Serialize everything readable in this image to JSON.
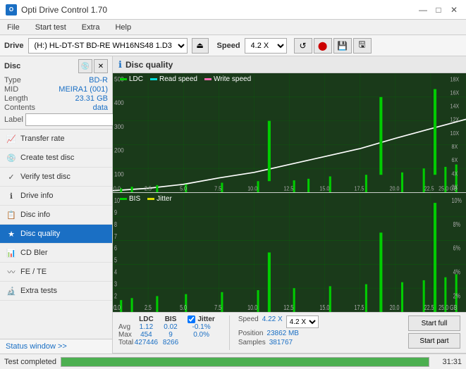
{
  "titleBar": {
    "title": "Opti Drive Control 1.70",
    "icon": "O",
    "minimizeBtn": "—",
    "maximizeBtn": "□",
    "closeBtn": "✕"
  },
  "menuBar": {
    "items": [
      "File",
      "Start test",
      "Extra",
      "Help"
    ]
  },
  "driveBar": {
    "label": "Drive",
    "driveValue": "(H:)  HL-DT-ST BD-RE  WH16NS48 1.D3",
    "speedLabel": "Speed",
    "speedValue": "4.2 X"
  },
  "sidebar": {
    "discTitle": "Disc",
    "discInfo": {
      "type": {
        "label": "Type",
        "value": "BD-R"
      },
      "mid": {
        "label": "MID",
        "value": "MEIRA1 (001)"
      },
      "length": {
        "label": "Length",
        "value": "23.31 GB"
      },
      "contents": {
        "label": "Contents",
        "value": "data"
      },
      "labelField": {
        "label": "Label",
        "placeholder": ""
      }
    },
    "navItems": [
      {
        "id": "transfer-rate",
        "label": "Transfer rate",
        "icon": "📈"
      },
      {
        "id": "create-test-disc",
        "label": "Create test disc",
        "icon": "💿"
      },
      {
        "id": "verify-test-disc",
        "label": "Verify test disc",
        "icon": "✓"
      },
      {
        "id": "drive-info",
        "label": "Drive info",
        "icon": "ℹ"
      },
      {
        "id": "disc-info",
        "label": "Disc info",
        "icon": "📋"
      },
      {
        "id": "disc-quality",
        "label": "Disc quality",
        "icon": "★",
        "active": true
      },
      {
        "id": "cd-bler",
        "label": "CD Bler",
        "icon": "📊"
      },
      {
        "id": "fe-te",
        "label": "FE / TE",
        "icon": "〰"
      },
      {
        "id": "extra-tests",
        "label": "Extra tests",
        "icon": "🔬"
      }
    ],
    "statusWindow": "Status window >>"
  },
  "discQuality": {
    "title": "Disc quality",
    "topChart": {
      "legend": [
        {
          "label": "LDC",
          "color": "#00aa00"
        },
        {
          "label": "Read speed",
          "color": "#00dddd"
        },
        {
          "label": "Write speed",
          "color": "#ff69b4"
        }
      ],
      "yAxisMax": 500,
      "yAxisLabels": [
        "500",
        "400",
        "300",
        "200",
        "100",
        "0"
      ],
      "yAxisRight": [
        "18X",
        "16X",
        "14X",
        "12X",
        "10X",
        "8X",
        "6X",
        "4X",
        "2X"
      ],
      "xAxisLabels": [
        "0.0",
        "2.5",
        "5.0",
        "7.5",
        "10.0",
        "12.5",
        "15.0",
        "17.5",
        "20.0",
        "22.5",
        "25.0 GB"
      ]
    },
    "bottomChart": {
      "legend": [
        {
          "label": "BIS",
          "color": "#00aa00"
        },
        {
          "label": "Jitter",
          "color": "#dddd00"
        }
      ],
      "yAxisMax": 10,
      "yAxisLabels": [
        "10",
        "9",
        "8",
        "7",
        "6",
        "5",
        "4",
        "3",
        "2",
        "1"
      ],
      "yAxisRight": [
        "10%",
        "8%",
        "6%",
        "4%",
        "2%"
      ],
      "xAxisLabels": [
        "0.0",
        "2.5",
        "5.0",
        "7.5",
        "10.0",
        "12.5",
        "15.0",
        "17.5",
        "20.0",
        "22.5",
        "25.0 GB"
      ]
    }
  },
  "statsBar": {
    "columns": [
      {
        "header": "",
        "rows": [
          "Avg",
          "Max",
          "Total"
        ]
      },
      {
        "header": "LDC",
        "rows": [
          "1.12",
          "454",
          "427446"
        ]
      },
      {
        "header": "BIS",
        "rows": [
          "0.02",
          "9",
          "8266"
        ]
      },
      {
        "header": "Jitter",
        "rows": [
          "-0.1%",
          "0.0%",
          ""
        ]
      }
    ],
    "jitter": {
      "checked": true,
      "label": "Jitter"
    },
    "speed": {
      "label": "Speed",
      "value": "4.22 X",
      "speedSelectValue": "4.2 X"
    },
    "position": {
      "label": "Position",
      "value": "23862 MB"
    },
    "samples": {
      "label": "Samples",
      "value": "381767"
    },
    "buttons": {
      "startFull": "Start full",
      "startPart": "Start part"
    }
  },
  "bottomStatus": {
    "text": "Test completed",
    "progress": 100,
    "time": "31:31"
  }
}
